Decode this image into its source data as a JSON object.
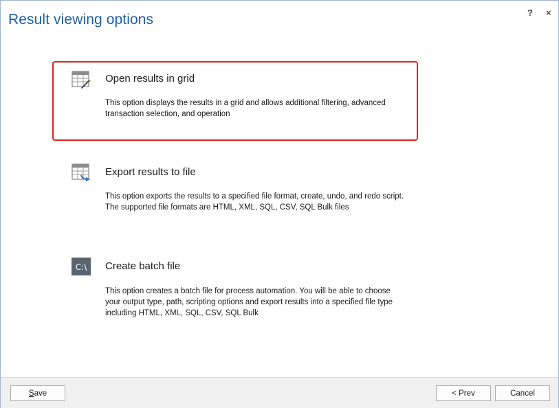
{
  "window": {
    "title": "Result viewing options",
    "help_label": "?",
    "close_label": "×"
  },
  "options": [
    {
      "title": "Open results in grid",
      "description": "This option displays the results in a grid and allows additional filtering, advanced transaction selection, and operation",
      "icon": "grid-edit-icon",
      "selected": true
    },
    {
      "title": "Export results to file",
      "description": "This option exports the results to a specified file format, create, undo, and redo script. The supported file formats are HTML, XML, SQL, CSV, SQL Bulk files",
      "icon": "grid-export-icon",
      "selected": false
    },
    {
      "title": "Create batch file",
      "description": "This option creates a batch file for process automation. You will be able to choose your output type, path, scripting options and export results into a specified file type including HTML, XML, SQL, CSV, SQL Bulk",
      "icon": "command-prompt-icon",
      "icon_text": "C:\\",
      "selected": false
    }
  ],
  "footer": {
    "save_mnemonic": "S",
    "save_rest": "ave",
    "prev_label": "< Prev",
    "cancel_label": "Cancel"
  },
  "colors": {
    "title": "#1e5d9c",
    "selection_border": "#e02020",
    "icon_blue": "#3a78c2",
    "footer_bg": "#f0f0f0"
  }
}
